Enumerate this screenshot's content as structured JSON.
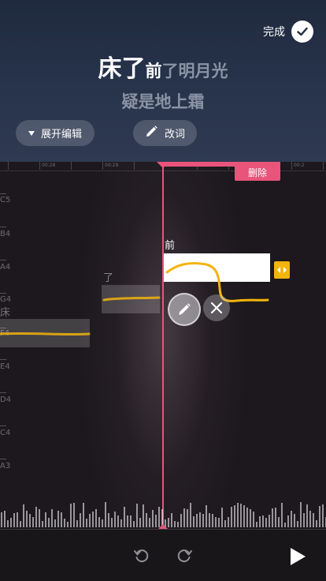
{
  "header": {
    "done_label": "完成",
    "lyric": {
      "sung": "床了",
      "current": "前",
      "upcoming": "了明月光",
      "next_line": "疑是地上霜"
    },
    "expand_label": "展开编辑",
    "rename_label": "改词"
  },
  "timeline": {
    "labels": [
      "00:28",
      "00:29",
      "00:2"
    ]
  },
  "pitch_labels": [
    "C5",
    "B4",
    "A4",
    "G4",
    "F4",
    "E4",
    "D4",
    "C4",
    "A3"
  ],
  "notes": [
    {
      "char": "床"
    },
    {
      "char": "了"
    },
    {
      "char": "前"
    }
  ],
  "editor": {
    "delete_label": "删除"
  },
  "colors": {
    "accent": "#e9547b",
    "pitch_curve": "#f3b40d",
    "header_bg": "#28344c"
  }
}
